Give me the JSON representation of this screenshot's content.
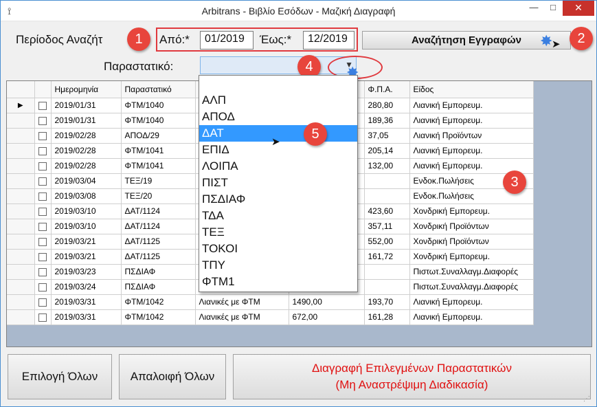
{
  "window": {
    "title": "Arbitrans - Βιβλίο Εσόδων - Μαζική Διαγραφή",
    "app_icon": "⟟"
  },
  "search": {
    "period_label": "Περίοδος Αναζήτ",
    "from_label": "Από:*",
    "from_value": "01/2019",
    "to_label": "Έως:*",
    "to_value": "12/2019",
    "button_label": "Αναζήτηση Εγγραφών",
    "document_label": "Παραστατικό:"
  },
  "badges": [
    "1",
    "2",
    "3",
    "4",
    "5"
  ],
  "grid": {
    "columns": [
      "Ημερομηνία",
      "Παραστατικό",
      "Φ.Π.Α.",
      "Είδος"
    ],
    "rows": [
      {
        "date": "2019/01/31",
        "doc": "ΦΤΜ/1040",
        "desc": "",
        "amount": "",
        "vat": "280,80",
        "kind": "Λιανική Εμπορευμ."
      },
      {
        "date": "2019/01/31",
        "doc": "ΦΤΜ/1040",
        "desc": "",
        "amount": "",
        "vat": "189,36",
        "kind": "Λιανική Εμπορευμ."
      },
      {
        "date": "2019/02/28",
        "doc": "ΑΠΟΔ/29",
        "desc": "",
        "amount": "",
        "vat": "37,05",
        "kind": "Λιανική Προϊόντων"
      },
      {
        "date": "2019/02/28",
        "doc": "ΦΤΜ/1041",
        "desc": "",
        "amount": "",
        "vat": "205,14",
        "kind": "Λιανική Εμπορευμ."
      },
      {
        "date": "2019/02/28",
        "doc": "ΦΤΜ/1041",
        "desc": "",
        "amount": "",
        "vat": "132,00",
        "kind": "Λιανική Εμπορευμ."
      },
      {
        "date": "2019/03/04",
        "doc": "ΤΕΞ/19",
        "desc": "",
        "amount": "",
        "vat": "",
        "kind": "Ενδοκ.Πωλήσεις"
      },
      {
        "date": "2019/03/08",
        "doc": "ΤΕΞ/20",
        "desc": "",
        "amount": "",
        "vat": "",
        "kind": "Ενδοκ.Πωλήσεις"
      },
      {
        "date": "2019/03/10",
        "doc": "ΔΑΤ/1124",
        "desc": "",
        "amount": "",
        "vat": "423,60",
        "kind": "Χονδρική Εμπορευμ."
      },
      {
        "date": "2019/03/10",
        "doc": "ΔΑΤ/1124",
        "desc": "",
        "amount": "",
        "vat": "357,11",
        "kind": "Χονδρική Προϊόντων"
      },
      {
        "date": "2019/03/21",
        "doc": "ΔΑΤ/1125",
        "desc": "",
        "amount": "",
        "vat": "552,00",
        "kind": "Χονδρική Προϊόντων"
      },
      {
        "date": "2019/03/21",
        "doc": "ΔΑΤ/1125",
        "desc": "",
        "amount": "",
        "vat": "161,72",
        "kind": "Χονδρική Εμπορευμ."
      },
      {
        "date": "2019/03/23",
        "doc": "ΠΣΔΙΑΦ",
        "desc": "",
        "amount": "",
        "vat": "",
        "kind": "Πιστωτ.Συναλλαγμ.Διαφορές"
      },
      {
        "date": "2019/03/24",
        "doc": "ΠΣΔΙΑΦ",
        "desc": "",
        "amount": "",
        "vat": "",
        "kind": "Πιστωτ.Συναλλαγμ.Διαφορές"
      },
      {
        "date": "2019/03/31",
        "doc": "ΦΤΜ/1042",
        "desc": "Λιανικές με ΦΤΜ",
        "amount": "1490,00",
        "vat": "193,70",
        "kind": "Λιανική Εμπορευμ."
      },
      {
        "date": "2019/03/31",
        "doc": "ΦΤΜ/1042",
        "desc": "Λιανικές με ΦΤΜ",
        "amount": "672,00",
        "vat": "161,28",
        "kind": "Λιανική Εμπορευμ."
      }
    ]
  },
  "dropdown": {
    "items": [
      "ΑΛΠ",
      "ΑΠΟΔ",
      "ΔΑΤ",
      "ΕΠΙΔ",
      "ΛΟΙΠΑ",
      "ΠΙΣΤ",
      "ΠΣΔΙΑΦ",
      "ΤΔΑ",
      "ΤΕΞ",
      "ΤΟΚΟΙ",
      "ΤΠΥ",
      "ΦΤΜ1"
    ],
    "selected_index": 2
  },
  "buttons": {
    "select_all": "Επιλογή Όλων",
    "deselect_all": "Απαλοιφή Όλων",
    "delete_line1": "Διαγραφή Επιλεγμένων Παραστατικών",
    "delete_line2": "(Μη Αναστρέψιμη Διαδικασία)"
  },
  "colors": {
    "accent_red": "#e8453c",
    "selection_blue": "#3399ff",
    "delete_text": "#e01010"
  }
}
